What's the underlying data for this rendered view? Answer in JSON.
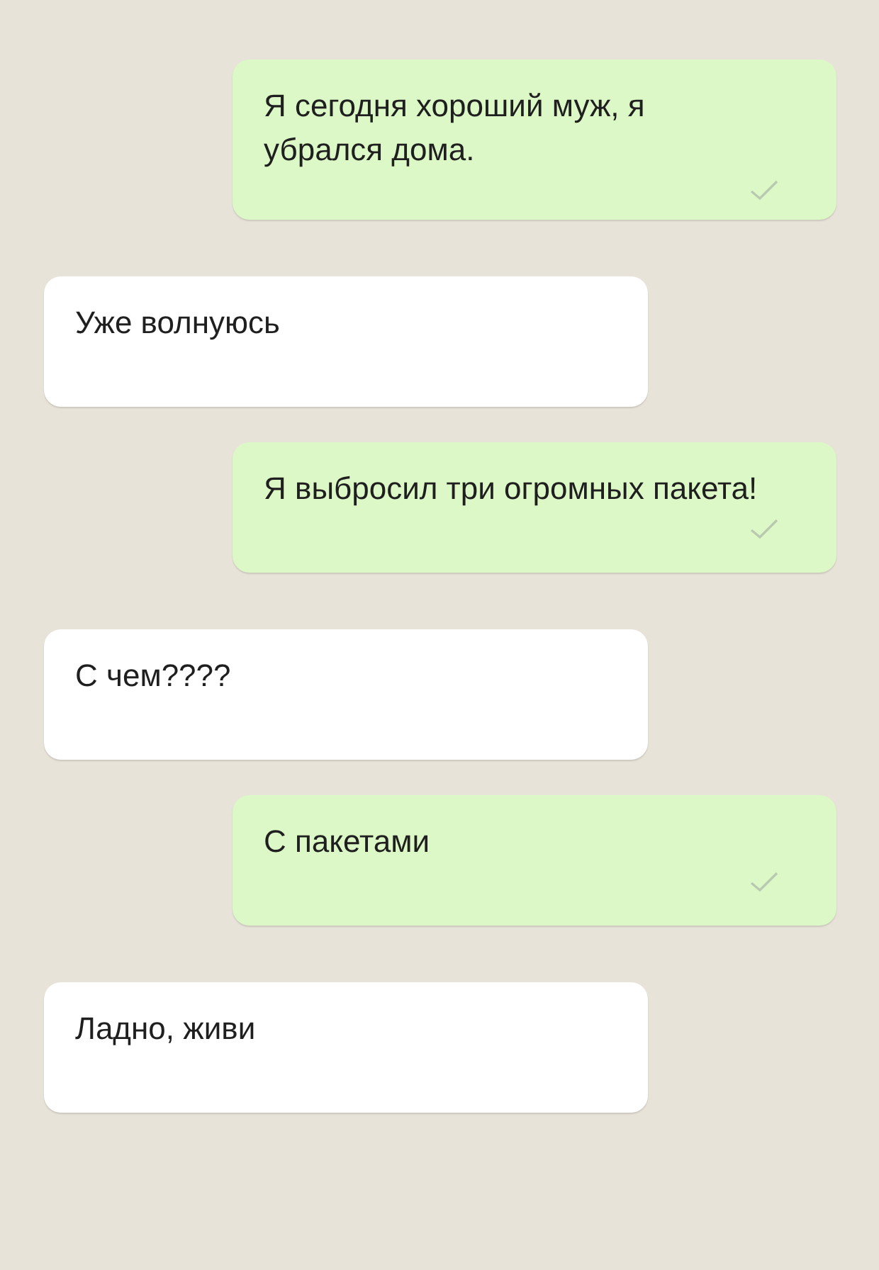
{
  "messages": [
    {
      "kind": "outgoing",
      "text": "Я сегодня хороший муж, я убрался дома."
    },
    {
      "kind": "incoming",
      "text": "Уже волнуюсь"
    },
    {
      "kind": "outgoing",
      "text": "Я выбросил три огромных пакета!"
    },
    {
      "kind": "incoming",
      "text": "С чем????"
    },
    {
      "kind": "outgoing",
      "text": "С пакетами"
    },
    {
      "kind": "incoming",
      "text": "Ладно, живи"
    }
  ]
}
